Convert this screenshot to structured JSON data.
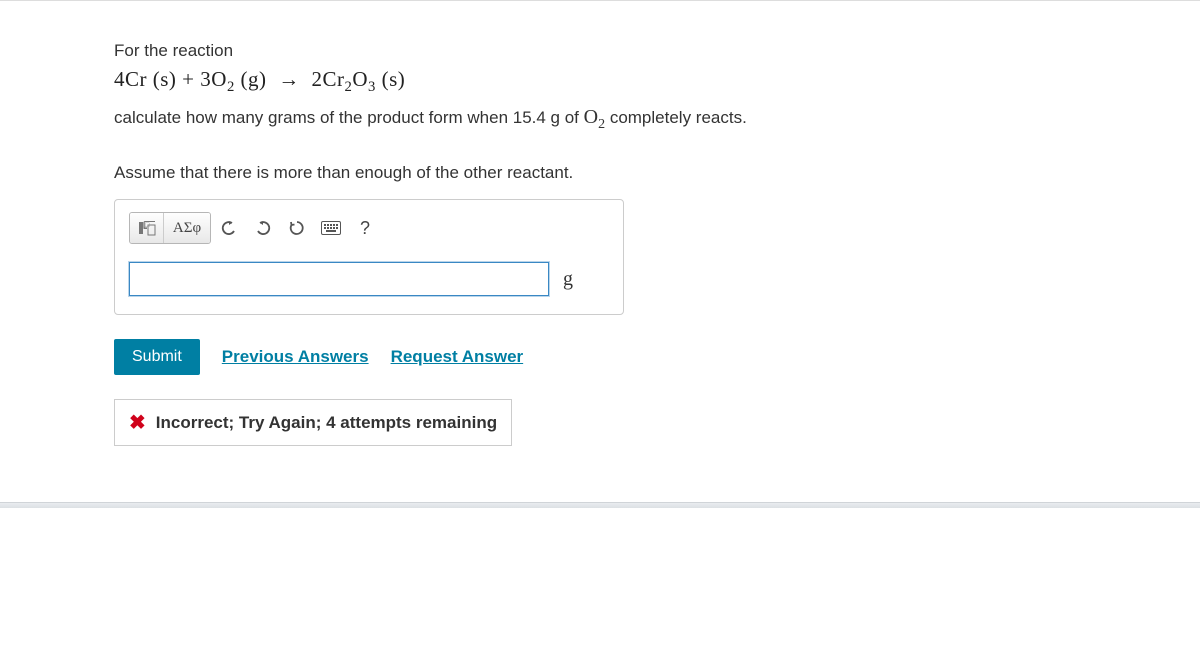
{
  "question": {
    "intro": "For the reaction",
    "equation_parts": {
      "lhs1_coef": "4",
      "lhs1_el": "Cr",
      "lhs1_state": "(s)",
      "plus": "+",
      "lhs2_coef": "3",
      "lhs2_el": "O",
      "lhs2_sub": "2",
      "lhs2_state": "(g)",
      "arrow": "→",
      "rhs_coef": "2",
      "rhs_el1": "Cr",
      "rhs_sub1": "2",
      "rhs_el2": "O",
      "rhs_sub2": "3",
      "rhs_state": "(s)"
    },
    "calc_prefix": "calculate how many grams of the product form when 15.4 g of ",
    "calc_chem_el": "O",
    "calc_chem_sub": "2",
    "calc_suffix": "  completely reacts.",
    "assume": "Assume that there is more than enough of the other reactant."
  },
  "toolbar": {
    "greek_label": "ΑΣφ",
    "help_label": "?"
  },
  "answer": {
    "value": "",
    "unit": "g"
  },
  "actions": {
    "submit": "Submit",
    "previous": "Previous Answers",
    "request": "Request Answer"
  },
  "feedback": {
    "text": "Incorrect; Try Again; 4 attempts remaining"
  }
}
